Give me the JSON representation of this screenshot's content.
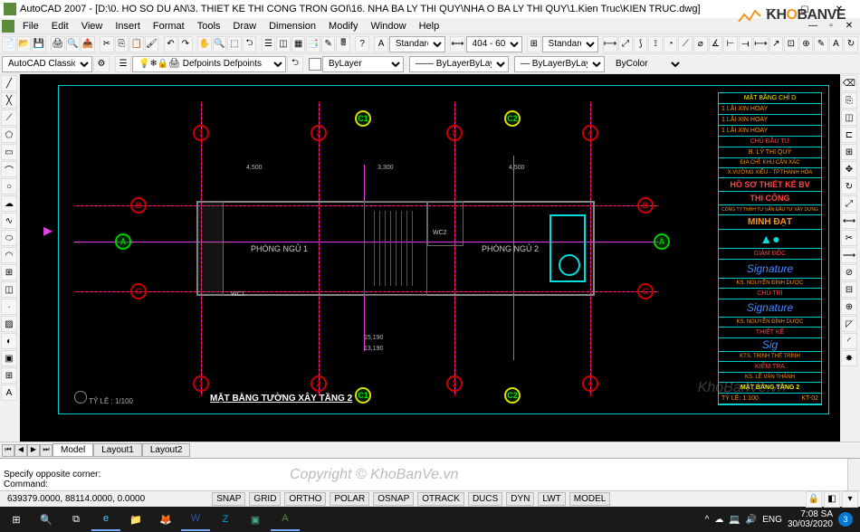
{
  "window": {
    "title": "AutoCAD 2007 - [D:\\0. HO SO DU AN\\3. THIET KE THI CONG TRON GOI\\16. NHA BA LY THI QUY\\NHA O BA LY THI QUY\\1.Kien Truc\\KIEN TRUC.dwg]",
    "min": "—",
    "max": "▢",
    "close": "✕"
  },
  "menus": [
    "File",
    "Edit",
    "View",
    "Insert",
    "Format",
    "Tools",
    "Draw",
    "Dimension",
    "Modify",
    "Window",
    "Help"
  ],
  "toolbar1": {
    "workspace_select": "AutoCAD Classic",
    "layer_select": "Defpoints",
    "layer_color": "#ffffff"
  },
  "toolbar2": {
    "linetype_label": "ByLayer",
    "lineweight_label": "ByLayer",
    "color_label": "ByColor",
    "style_select": "Standard",
    "dim_select": "404 - 60",
    "table_select": "Standard"
  },
  "canvas": {
    "drawing_title": "MẶT BẰNG TƯỜNG XÂY TẦNG 2",
    "rooms": {
      "room1": "PHÒNG NGỦ 1",
      "room2": "PHÒNG NGỦ 2",
      "wc1": "WC1",
      "wc2": "WC2"
    },
    "axes": {
      "v": [
        "1",
        "2",
        "3",
        "4"
      ],
      "h": [
        "A",
        "B"
      ]
    },
    "title_block": {
      "section_labels": [
        "MẶT BẦNG CHỈ D",
        "1   LÃI XIN HOAY",
        "1   LÃI XIN HOAY",
        "1   LÃI XIN HOAY"
      ],
      "owner_title": "CHỦ ĐẦU TƯ",
      "owner": "B. LÝ THI QUÝ",
      "address": "ĐỊA CHỈ: KHU CẦN XÁC",
      "province": "X.VƯỜNG XIÊU - TP.THANH HÓA",
      "project": "HỒ SƠ THIẾT KẾ BV",
      "project2": "THI CÔNG",
      "company": "CÔNG TY TNHH TƯ VẤN ĐẦU TƯ XÂY DỰNG",
      "company2": "MINH ĐẠT",
      "director": "GIÁM ĐỐC",
      "sig1": "KS. NGUYỄN ĐÌNH DƯỢC",
      "role2": "CHỦ TRÌ",
      "sig2": "KS. NGUYỄN ĐÌNH DƯỢC",
      "role3": "THIẾT KẾ",
      "sig3": "KTS. TRỊNH THẾ TRÌNH",
      "role4": "KIỂM TRA",
      "sig4": "KS. LÊ VĂN THÀNH",
      "drawing": "MẶT BẰNG TẦNG 2",
      "sheet": "KT-02",
      "scale": "TỶ LỆ: 1:100"
    },
    "footer_scale": "TỶ LỆ : 1/100"
  },
  "tabs": {
    "model": "Model",
    "layout1": "Layout1",
    "layout2": "Layout2"
  },
  "command": {
    "line1": "Specify opposite corner:",
    "line2": "Command:"
  },
  "status": {
    "coords": "639379.0000, 88114.0000, 0.0000",
    "buttons": [
      "SNAP",
      "GRID",
      "ORTHO",
      "POLAR",
      "OSNAP",
      "OTRACK",
      "DUCS",
      "DYN",
      "LWT",
      "MODEL"
    ]
  },
  "taskbar": {
    "tray": {
      "lang": "ENG",
      "time": "7:08 SA",
      "date": "30/03/2020",
      "notif": "3"
    }
  },
  "watermark": {
    "brand1": "KH",
    "brand2": "O",
    "brand3": "BANVE",
    "url": "KhoBanVe.vn",
    "copy": "Copyright © KhoBanVe.vn"
  }
}
